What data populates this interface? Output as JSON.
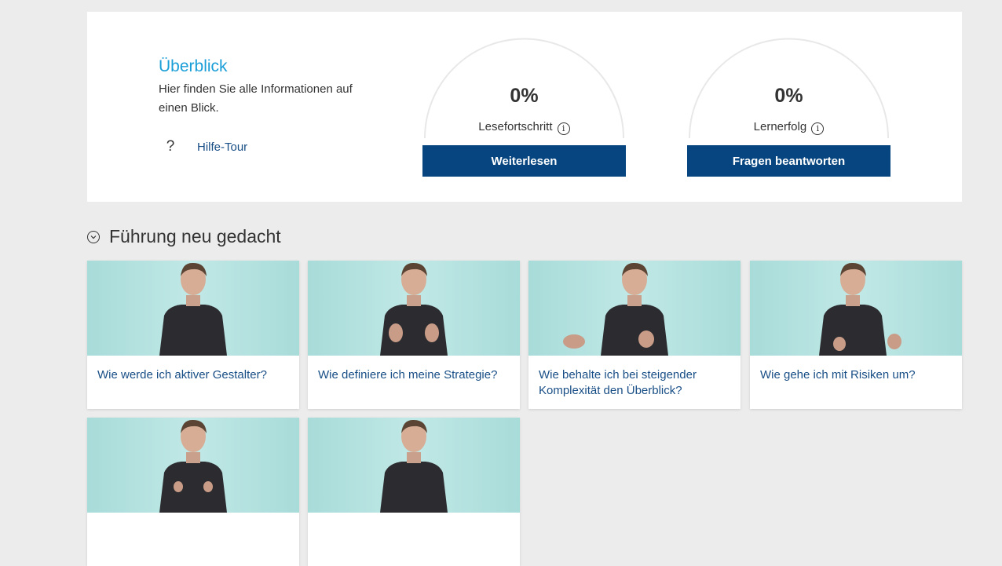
{
  "overview": {
    "title": "Überblick",
    "description": "Hier finden Sie alle Informationen auf einen Blick.",
    "help_link": "Hilfe-Tour"
  },
  "gauges": [
    {
      "value": "0%",
      "label": "Lesefortschritt",
      "button": "Weiterlesen",
      "progress_fraction": 0
    },
    {
      "value": "0%",
      "label": "Lernerfolg",
      "button": "Fragen beantworten",
      "progress_fraction": 0
    }
  ],
  "section": {
    "title": "Führung neu gedacht"
  },
  "cards": [
    {
      "title": "Wie werde ich aktiver Gestalter?"
    },
    {
      "title": "Wie definiere ich meine Strategie?"
    },
    {
      "title": "Wie behalte ich bei steigender Komplexität den Überblick?"
    },
    {
      "title": "Wie gehe ich mit Risiken um?"
    },
    {
      "title": ""
    },
    {
      "title": ""
    }
  ],
  "colors": {
    "accent": "#1a9ed8",
    "button": "#06457f",
    "link": "#184e86",
    "background": "#ececec",
    "thumbnail": "#b5e3e1"
  },
  "icons": {
    "help": "question-mark",
    "info": "info-circle",
    "section_toggle": "chevron-down-circle"
  }
}
